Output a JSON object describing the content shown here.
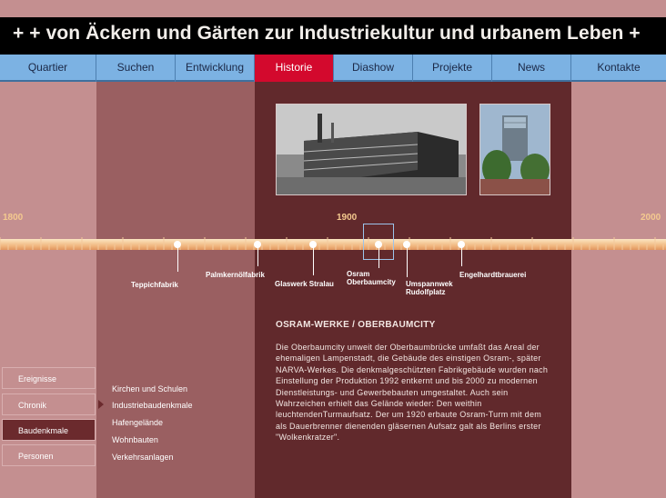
{
  "header": {
    "title": "+ + von Äckern und Gärten zur Industriekultur und urbanem Leben +"
  },
  "nav": {
    "items": [
      {
        "label": "Quartier",
        "active": false
      },
      {
        "label": "Suchen",
        "active": false
      },
      {
        "label": "Entwicklung",
        "active": false
      },
      {
        "label": "Historie",
        "active": true
      },
      {
        "label": "Diashow",
        "active": false
      },
      {
        "label": "Projekte",
        "active": false
      },
      {
        "label": "News",
        "active": false
      },
      {
        "label": "Kontakte",
        "active": false
      }
    ]
  },
  "timeline": {
    "year_start": "1800",
    "year_mid": "1900",
    "year_end": "2000",
    "events": [
      {
        "label": "Teppichfabrik"
      },
      {
        "label": "Palmkernölfabrik"
      },
      {
        "label": "Glaswerk Stralau"
      },
      {
        "label": "Osram\nOberbaumcity"
      },
      {
        "label": "Umspannwek\nRudolfplatz"
      },
      {
        "label": "Engelhardtbrauerei"
      }
    ]
  },
  "article": {
    "heading": "OSRAM-WERKE / OBERBAUMCITY",
    "body": "Die Oberbaumcity unweit der Oberbaumbrücke umfaßt das Areal der ehemaligen Lampenstadt, die Gebäude des einstigen Osram-, später NARVA-Werkes. Die denkmalgeschützten Fabrikgebäude wurden nach Einstellung der Produktion 1992 entkernt und bis 2000 zu modernen Dienstleistungs- und Gewerbebauten umgestaltet. Auch sein Wahrzeichen erhielt das Gelände wieder: Den weithin leuchtendenTurmaufsatz. Der um 1920 erbaute Osram-Turm mit dem als Dauerbrenner dienenden gläsernen Aufsatz galt als Berlins erster \"Wolkenkratzer\"."
  },
  "left_menu": {
    "items": [
      {
        "label": "Ereignisse",
        "active": false
      },
      {
        "label": "Chronik",
        "active": false
      },
      {
        "label": "Baudenkmale",
        "active": true
      },
      {
        "label": "Personen",
        "active": false
      }
    ]
  },
  "sub_menu": {
    "items": [
      "Kirchen und Schulen",
      "Industriebaudenkmale",
      "Hafengelände",
      "Wohnbauten",
      "Verkehrsanlagen"
    ]
  },
  "colors": {
    "background": "#c48f90",
    "nav_blue": "#7cb2e3",
    "nav_active": "#d3092d",
    "dark_panel": "#61292c",
    "mid_panel": "#9a5f61",
    "year_text": "#f4c98f"
  }
}
